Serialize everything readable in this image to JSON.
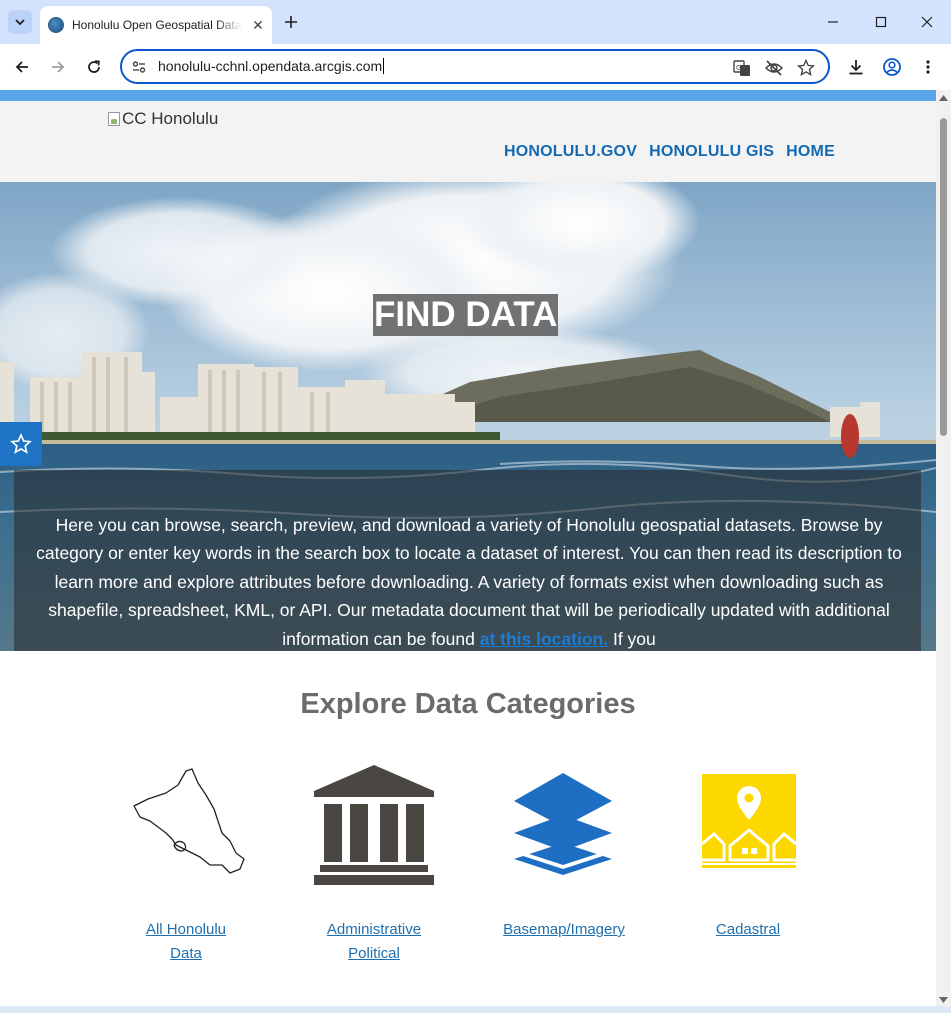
{
  "browser": {
    "tab_title": "Honolulu Open Geospatial Data",
    "tab_close": "✕",
    "new_tab": "+",
    "url": "honolulu-cchnl.opendata.arcgis.com"
  },
  "site": {
    "logo_alt": "CC Honolulu",
    "nav": [
      "HONOLULU.GOV",
      "HONOLULU GIS",
      "HOME"
    ]
  },
  "hero": {
    "title": "FIND DATA",
    "text_before_link": "Here you can browse, search, preview, and download a variety of Honolulu geospatial datasets. Browse by category or enter key words in the search box to locate a dataset of interest. You can then read its description to learn more and explore attributes before downloading. A variety of formats exist when downloading such as shapefile, spreadsheet, KML, or API.  Our metadata document that will be periodically updated with additional information can be found ",
    "link_text": "at this location.",
    "text_after_link": "  If you"
  },
  "categories": {
    "heading": "Explore Data Categories",
    "items": [
      {
        "line1": "All Honolulu",
        "line2": "Data",
        "icon": "oahu-map-icon"
      },
      {
        "line1": "Administrative",
        "line2": "Political",
        "icon": "government-building-icon"
      },
      {
        "line1": "Basemap/Imagery",
        "line2": "",
        "icon": "layers-icon"
      },
      {
        "line1": "Cadastral",
        "line2": "",
        "icon": "parcel-houses-icon"
      }
    ]
  },
  "colors": {
    "accent_bar": "#5aa4e8",
    "nav_link": "#1469b3",
    "category_link": "#1e6fb0",
    "layers_blue": "#1e6fc4",
    "cadastral_yellow": "#fcd700",
    "building_gray": "#4a4743"
  }
}
